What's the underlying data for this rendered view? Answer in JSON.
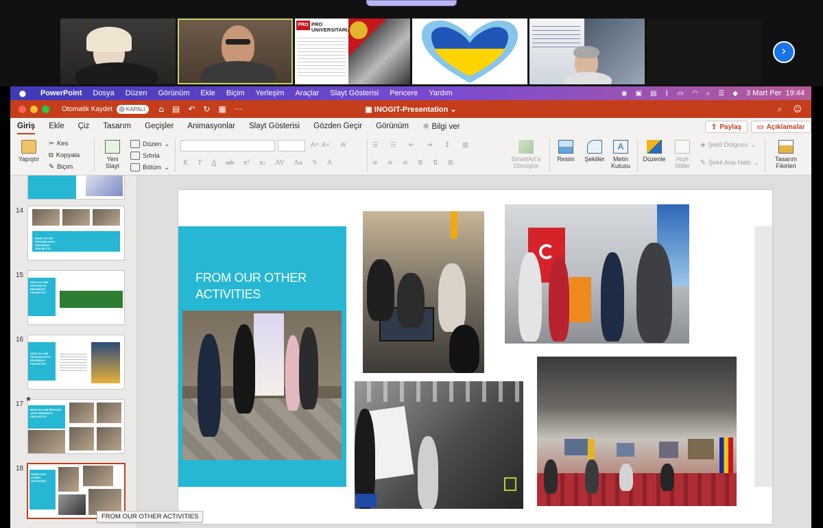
{
  "call": {
    "tiles": [
      {
        "name": "participant-1"
      },
      {
        "name": "participant-2"
      },
      {
        "name": "participant-3",
        "text_title": "PRO UNIVERSITARIA"
      },
      {
        "name": "participant-4"
      },
      {
        "name": "participant-5"
      },
      {
        "name": "participant-6"
      }
    ],
    "next_icon": "chevron-right-icon"
  },
  "menubar": {
    "app": "PowerPoint",
    "items": [
      "Dosya",
      "Düzen",
      "Görünüm",
      "Ekle",
      "Biçim",
      "Yerleşim",
      "Araçlar",
      "Slayt Gösterisi",
      "Pencere",
      "Yardım"
    ],
    "datetime": "3 Mart Per  19:44"
  },
  "titlebar": {
    "autosave_label": "Otomatik Kaydet",
    "autosave_state": "KAPALI",
    "doc_title": "INOGIT-Presentation"
  },
  "ribbon": {
    "tabs": [
      "Giriş",
      "Ekle",
      "Çiz",
      "Tasarım",
      "Geçişler",
      "Animasyonlar",
      "Slayt Gösterisi",
      "Gözden Geçir",
      "Görünüm"
    ],
    "tell_me": "Bilgi ver",
    "share": "Paylaş",
    "comments": "Açıklamalar",
    "paste": "Yapıştır",
    "cut": "Kes",
    "copy": "Kopyala",
    "format": "Biçim",
    "new_slide_1": "Yeni",
    "new_slide_2": "Slayt",
    "layout": "Düzen",
    "reset": "Sıfırla",
    "section": "Bölüm",
    "smartart_1": "SmartArt'a",
    "smartart_2": "Dönüştür",
    "picture": "Resim",
    "shapes": "Şekiller",
    "textbox_1": "Metin",
    "textbox_2": "Kutusu",
    "arrange": "Düzenle",
    "quick_styles_1": "Hızlı",
    "quick_styles_2": "Stiller",
    "shape_fill": "Şekil Dolgusu",
    "shape_outline": "Şekil Ana Hattı",
    "designer_1": "Tasarım",
    "designer_2": "Fikirleri"
  },
  "thumbnails": [
    {
      "num": "14",
      "title": "WHAT DO WE PROVIDE WITH ERASMUS+ PROJECTS?"
    },
    {
      "num": "15",
      "title": "WHAT DO WE PROVIDE IN ERASMUS+ PROJECTS?"
    },
    {
      "num": "16",
      "title": "WHAT DO WE PROVIDE WITH ERASMUS+ PROJECTS?"
    },
    {
      "num": "17",
      "title": "WHAT DO WE PROVIDE WITH ERASMUS+ PROJECTS?"
    },
    {
      "num": "18",
      "title": "FROM OUR OTHER ACTIVITIES"
    }
  ],
  "tooltip": "FROM OUR OTHER ACTIVITIES",
  "slide": {
    "title": "FROM OUR OTHER ACTIVITIES",
    "accent": "#25b7d3"
  },
  "colors": {
    "ppt_red": "#c43e1c",
    "menubar_gradient_start": "#3e3ab6",
    "teal": "#25b7d3"
  }
}
